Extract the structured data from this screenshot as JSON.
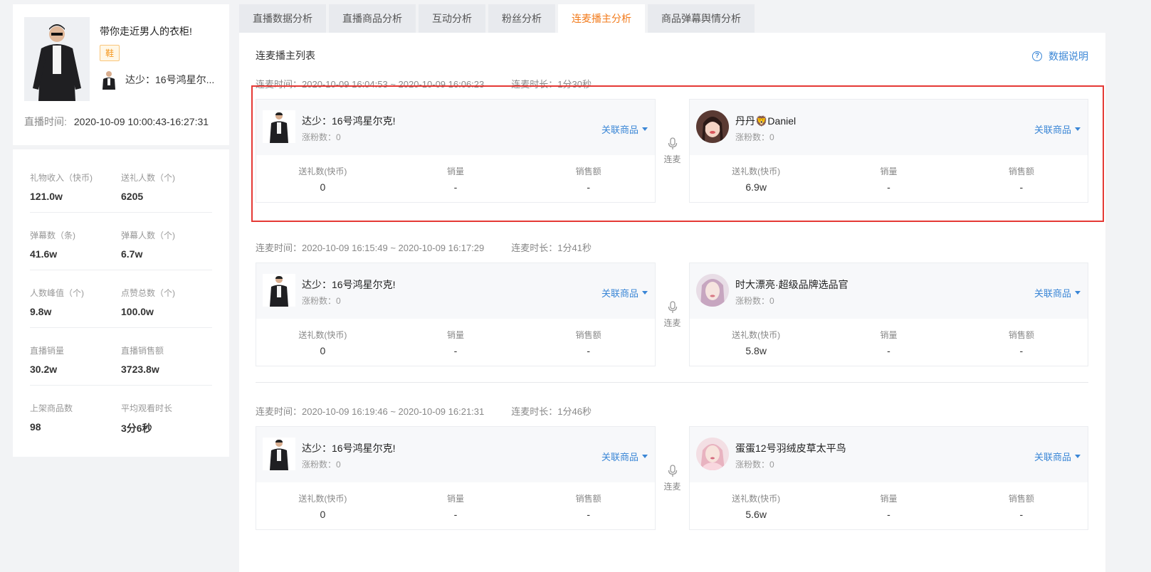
{
  "anchor": {
    "title": "带你走近男人的衣柜!",
    "tag": "鞋",
    "name": "达少：16号鸿星尔...",
    "live_time_label": "直播时间:",
    "live_time_value": "2020-10-09 10:00:43-16:27:31"
  },
  "stats": [
    [
      {
        "k": "礼物收入（快币)",
        "v": "121.0w"
      },
      {
        "k": "送礼人数（个)",
        "v": "6205"
      }
    ],
    [
      {
        "k": "弹幕数（条)",
        "v": "41.6w"
      },
      {
        "k": "弹幕人数（个)",
        "v": "6.7w"
      }
    ],
    [
      {
        "k": "人数峰值（个)",
        "v": "9.8w"
      },
      {
        "k": "点赞总数（个)",
        "v": "100.0w"
      }
    ],
    [
      {
        "k": "直播销量",
        "v": "30.2w"
      },
      {
        "k": "直播销售额",
        "v": "3723.8w"
      }
    ],
    [
      {
        "k": "上架商品数",
        "v": "98"
      },
      {
        "k": "平均观看时长",
        "v": "3分6秒"
      }
    ]
  ],
  "tabs": [
    "直播数据分析",
    "直播商品分析",
    "互动分析",
    "粉丝分析",
    "连麦播主分析",
    "商品弹幕舆情分析"
  ],
  "active_tab": 4,
  "list_title": "连麦播主列表",
  "help_label": "数据说明",
  "rel_label": "关联商品",
  "mic_label": "连麦",
  "fans_prefix": "涨粉数：",
  "stat_labels": {
    "gift": "送礼数(快币)",
    "sales": "销量",
    "amount": "销售额"
  },
  "sessions": [
    {
      "time": "连麦时间：2020-10-09 16:04:53 ~ 2020-10-09 16:06:23",
      "duration": "连麦时长：1分30秒",
      "left": {
        "name": "达少：16号鸿星尔克!",
        "fans": "涨粉数：0",
        "gift": "0",
        "sales": "-",
        "amount": "-"
      },
      "right": {
        "name": "丹丹🦁Daniel",
        "fans": "涨粉数：0",
        "gift": "6.9w",
        "sales": "-",
        "amount": "-"
      }
    },
    {
      "time": "连麦时间：2020-10-09 16:15:49 ~ 2020-10-09 16:17:29",
      "duration": "连麦时长：1分41秒",
      "left": {
        "name": "达少：16号鸿星尔克!",
        "fans": "涨粉数：0",
        "gift": "0",
        "sales": "-",
        "amount": "-"
      },
      "right": {
        "name": "时大漂亮·超级品牌选品官",
        "fans": "涨粉数：0",
        "gift": "5.8w",
        "sales": "-",
        "amount": "-"
      }
    },
    {
      "time": "连麦时间：2020-10-09 16:19:46 ~ 2020-10-09 16:21:31",
      "duration": "连麦时长：1分46秒",
      "left": {
        "name": "达少：16号鸿星尔克!",
        "fans": "涨粉数：0",
        "gift": "0",
        "sales": "-",
        "amount": "-"
      },
      "right": {
        "name": "蛋蛋12号羽绒皮草太平鸟",
        "fans": "涨粉数：0",
        "gift": "5.6w",
        "sales": "-",
        "amount": "-"
      }
    }
  ],
  "colors": {
    "accent": "#f27b1c",
    "link": "#3a86d6",
    "highlight": "#e53935",
    "tag": "#f59a23"
  }
}
